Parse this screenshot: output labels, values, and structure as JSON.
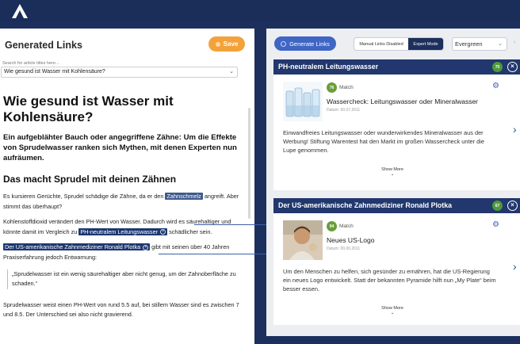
{
  "header": {
    "logo_icon": "app-logo-icon"
  },
  "left": {
    "title": "Generated Links",
    "save_label": "Save",
    "search_label": "Search for article titles here...",
    "search_value": "Wie gesund ist Wasser mit Kohlensäure?",
    "article": {
      "title": "Wie gesund ist Wasser mit Kohlensäure?",
      "lead": "Ein aufgeblähter Bauch oder angegriffene Zähne: Um die Effekte von Sprudelwasser ranken sich Mythen, mit denen Experten nun aufräumen.",
      "h2": "Das macht Sprudel mit deinen Zähnen",
      "p1_a": "Es kursieren Gerüchte, Sprudel schädige die Zähne, da er den ",
      "p1_hl": "Zahnschmelz",
      "p1_b": " angreift. Aber stimmt das überhaupt?",
      "p2_a": "Kohlenstoffdioxid verändert den PH-Wert von Wasser. Dadurch wird es säurehaltiger und könnte damit im Vergleich zu ",
      "p2_hl": "PH-neutralem Leitungswasser",
      "p2_b": " schädlicher sein.",
      "p3_hl": "Der US-amerikanische Zahnmediziner Ronald Plotka",
      "p3_b": " gibt mit seinen über 40 Jahren Praxiserfahrung jedoch Entwarnung:",
      "quote": "„Sprudelwasser ist ein wenig säurehaltiger aber nicht genug, um der Zahnoberfläche zu schaden.“",
      "p4": "Sprudelwasser weist einen PH-Wert von rund 5.5 auf, bei stillem Wasser sind es zwischen 7 und 8.5. Der Unterschied sei also nicht gravierend."
    }
  },
  "right": {
    "generate_label": "Generate Links",
    "toggle_off": "Manual Links Disabled",
    "toggle_on": "Expert Mode",
    "evergreen": "Evergreen",
    "cards": [
      {
        "heading": "PH-neutralem Leitungswasser",
        "score": "75",
        "match_score": "76",
        "match_label": "Match",
        "title": "Wassercheck: Leitungswasser oder Mineralwasser",
        "date": "Datum: 00.07.2011",
        "desc": "Einwandfreies Leitungswasser oder wunderwirkendes Mineralwasser aus der Werbung! Stiftung Warentest hat den Markt im großen Wassercheck unter die Lupe genommen.",
        "more": "Show More"
      },
      {
        "heading": "Der US-amerikanische Zahnmediziner Ronald Plotka",
        "score": "67",
        "match_score": "94",
        "match_label": "Match",
        "title": "Neues US-Logo",
        "date": "Datum: 00.00.2011",
        "desc": "Um den Menschen zu helfen, sich gesünder zu ernähren, hat die US-Regierung ein neues Logo entwickelt. Statt der bekannten Pyramide hilft nun „My Plate“ beim besser essen.",
        "more": "Show More"
      }
    ]
  },
  "colors": {
    "navy": "#1d2f5c",
    "card_head": "#21376d",
    "accent_blue": "#3f66c4",
    "save_orange": "#f3a23a",
    "match_green": "#6a9e3a"
  }
}
